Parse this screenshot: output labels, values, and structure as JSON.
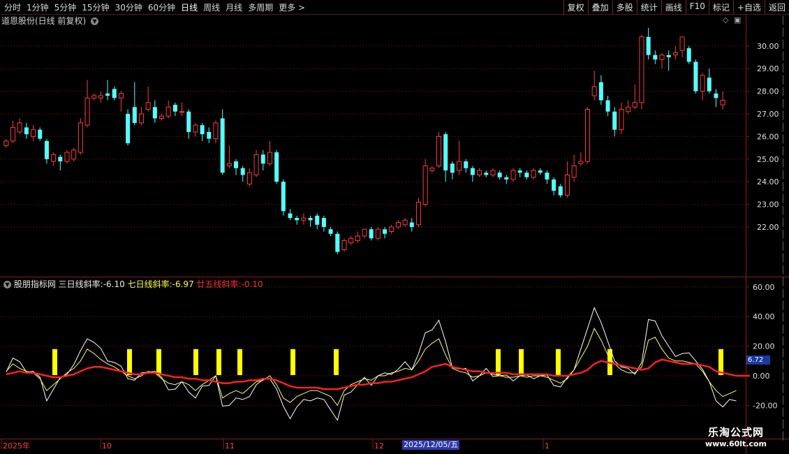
{
  "toolbar": {
    "periods": [
      "分时",
      "1分钟",
      "5分钟",
      "15分钟",
      "30分钟",
      "60分钟",
      "日线",
      "周线",
      "月线",
      "多周期",
      "更多 >"
    ],
    "active_period": "日线",
    "actions": [
      "复权",
      "叠加",
      "多股",
      "统计",
      "画线",
      "F10",
      "标记",
      "+自选",
      "返回"
    ]
  },
  "main_panel": {
    "title": "道恩股份(日线 前复权)",
    "price_ticks": [
      "30.00",
      "29.00",
      "28.00",
      "27.00",
      "26.00",
      "25.00",
      "24.00",
      "23.00",
      "22.00"
    ]
  },
  "indicator_panel": {
    "name": "股朋指标网",
    "line1_label": "三日线斜率:",
    "line1_value": "-6.10",
    "line2_label": "七日线斜率:",
    "line2_value": "-6.97",
    "line3_label": "廿五线斜率:",
    "line3_value": "-0.10",
    "ticks": [
      "60.00",
      "40.00",
      "20.00",
      "0.00",
      "-20.00"
    ],
    "current_value": "6.72"
  },
  "date_axis": {
    "labels": [
      "2025年",
      "10",
      "11",
      "12",
      "1"
    ],
    "cursor_date": "2025/12/05/五"
  },
  "watermark": {
    "line1": "乐淘公式网",
    "line2": "www.60lt.com"
  },
  "colors": {
    "up": "#ff3b3b",
    "down": "#54ffff",
    "bg": "#000000",
    "grid": "#7a1a1a",
    "signal": "#ffff00"
  },
  "chart_data": {
    "type": "candlestick",
    "price_axis": {
      "ylim": [
        21.0,
        31.0
      ]
    },
    "candles": [
      [
        25.6,
        25.8,
        25.5,
        25.9
      ],
      [
        25.8,
        26.4,
        25.7,
        26.7
      ],
      [
        26.2,
        26.6,
        26.1,
        26.8
      ],
      [
        26.4,
        26.1,
        25.9,
        26.6
      ],
      [
        26.0,
        26.3,
        25.8,
        26.5
      ],
      [
        26.3,
        25.9,
        25.8,
        26.4
      ],
      [
        25.8,
        25.0,
        24.8,
        25.9
      ],
      [
        24.9,
        25.2,
        24.7,
        25.3
      ],
      [
        25.1,
        24.9,
        24.5,
        25.2
      ],
      [
        24.9,
        25.3,
        24.8,
        25.4
      ],
      [
        25.0,
        25.4,
        24.9,
        25.5
      ],
      [
        25.3,
        26.6,
        25.2,
        26.8
      ],
      [
        26.5,
        27.7,
        26.4,
        28.5
      ],
      [
        27.7,
        27.8,
        27.6,
        27.9
      ],
      [
        27.7,
        27.8,
        27.5,
        28.0
      ],
      [
        27.9,
        27.8,
        27.6,
        28.5
      ],
      [
        28.1,
        27.7,
        27.6,
        28.2
      ],
      [
        27.7,
        27.9,
        27.1,
        28.0
      ],
      [
        27.0,
        25.7,
        25.6,
        27.2
      ],
      [
        27.3,
        26.6,
        26.5,
        28.4
      ],
      [
        26.6,
        27.0,
        26.5,
        27.3
      ],
      [
        27.2,
        27.5,
        27.1,
        28.2
      ],
      [
        27.3,
        26.8,
        26.6,
        27.6
      ],
      [
        26.8,
        26.9,
        26.7,
        27.0
      ],
      [
        26.9,
        27.3,
        26.8,
        27.6
      ],
      [
        27.4,
        27.1,
        26.9,
        27.5
      ],
      [
        27.1,
        27.1,
        26.9,
        27.5
      ],
      [
        27.1,
        26.2,
        25.9,
        27.2
      ],
      [
        26.2,
        26.5,
        26.0,
        26.6
      ],
      [
        26.5,
        26.1,
        25.8,
        26.6
      ],
      [
        26.2,
        25.9,
        25.7,
        26.4
      ],
      [
        25.9,
        26.6,
        25.7,
        26.7
      ],
      [
        26.8,
        24.4,
        24.3,
        27.2
      ],
      [
        24.7,
        24.8,
        24.6,
        25.6
      ],
      [
        24.9,
        24.6,
        24.3,
        25.0
      ],
      [
        24.6,
        24.3,
        24.0,
        24.7
      ],
      [
        23.9,
        24.4,
        23.8,
        24.6
      ],
      [
        24.3,
        25.2,
        24.2,
        25.4
      ],
      [
        25.2,
        24.8,
        24.5,
        25.4
      ],
      [
        24.8,
        25.3,
        24.7,
        25.8
      ],
      [
        25.3,
        24.0,
        23.9,
        25.4
      ],
      [
        24.0,
        22.7,
        22.5,
        24.1
      ],
      [
        22.6,
        22.4,
        22.3,
        22.8
      ],
      [
        22.4,
        22.3,
        22.1,
        22.5
      ],
      [
        22.3,
        22.4,
        22.1,
        22.6
      ],
      [
        22.4,
        22.3,
        22.0,
        22.5
      ],
      [
        22.5,
        22.1,
        21.9,
        22.6
      ],
      [
        22.4,
        22.0,
        21.8,
        22.5
      ],
      [
        21.9,
        21.7,
        21.6,
        22.0
      ],
      [
        21.7,
        20.9,
        20.8,
        21.8
      ],
      [
        21.0,
        21.4,
        20.9,
        21.5
      ],
      [
        21.3,
        21.5,
        21.2,
        21.6
      ],
      [
        21.4,
        21.6,
        21.3,
        21.8
      ],
      [
        21.6,
        21.9,
        21.5,
        21.9
      ],
      [
        21.9,
        21.5,
        21.4,
        22.0
      ],
      [
        21.5,
        21.9,
        21.4,
        22.0
      ],
      [
        21.9,
        21.7,
        21.5,
        22.0
      ],
      [
        21.8,
        22.0,
        21.7,
        22.1
      ],
      [
        22.0,
        22.2,
        21.9,
        22.3
      ],
      [
        22.1,
        22.3,
        22.0,
        22.4
      ],
      [
        22.2,
        22.0,
        21.8,
        22.4
      ],
      [
        22.1,
        23.1,
        22.0,
        23.3
      ],
      [
        23.0,
        24.7,
        22.9,
        25.0
      ],
      [
        24.5,
        24.6,
        24.4,
        24.7
      ],
      [
        24.7,
        26.0,
        24.6,
        26.2
      ],
      [
        26.1,
        24.5,
        24.0,
        26.2
      ],
      [
        24.8,
        24.4,
        24.1,
        24.9
      ],
      [
        24.5,
        24.9,
        24.3,
        25.8
      ],
      [
        24.9,
        24.6,
        24.4,
        25.0
      ],
      [
        24.6,
        24.3,
        24.0,
        24.7
      ],
      [
        24.3,
        24.5,
        24.2,
        24.6
      ],
      [
        24.4,
        24.3,
        24.2,
        24.5
      ],
      [
        24.3,
        24.5,
        24.2,
        24.6
      ],
      [
        24.4,
        24.2,
        24.1,
        24.5
      ],
      [
        24.2,
        24.1,
        23.9,
        24.3
      ],
      [
        24.1,
        24.5,
        24.0,
        24.6
      ],
      [
        24.5,
        24.4,
        24.2,
        24.6
      ],
      [
        24.4,
        24.2,
        24.1,
        24.5
      ],
      [
        24.2,
        24.5,
        24.1,
        24.6
      ],
      [
        24.5,
        24.4,
        24.3,
        24.6
      ],
      [
        24.4,
        24.1,
        23.9,
        24.5
      ],
      [
        24.1,
        23.6,
        23.4,
        24.2
      ],
      [
        23.8,
        23.4,
        23.3,
        23.9
      ],
      [
        23.4,
        24.3,
        23.3,
        24.9
      ],
      [
        24.2,
        24.7,
        24.0,
        25.2
      ],
      [
        24.8,
        24.9,
        24.7,
        25.3
      ],
      [
        24.9,
        27.2,
        24.8,
        27.3
      ],
      [
        27.8,
        28.2,
        27.6,
        28.9
      ],
      [
        28.4,
        27.6,
        27.4,
        28.7
      ],
      [
        27.6,
        27.1,
        26.9,
        27.8
      ],
      [
        27.1,
        26.3,
        26.0,
        27.3
      ],
      [
        26.3,
        27.2,
        26.1,
        27.5
      ],
      [
        27.1,
        27.3,
        27.0,
        27.6
      ],
      [
        27.3,
        27.5,
        27.2,
        28.3
      ],
      [
        27.5,
        30.4,
        27.2,
        30.5
      ],
      [
        30.4,
        29.6,
        29.4,
        30.8
      ],
      [
        29.6,
        29.4,
        29.2,
        29.8
      ],
      [
        29.4,
        29.6,
        29.0,
        29.7
      ],
      [
        29.6,
        29.5,
        28.9,
        29.8
      ],
      [
        29.6,
        29.7,
        29.4,
        30.0
      ],
      [
        29.8,
        30.4,
        29.5,
        30.4
      ],
      [
        29.9,
        29.3,
        29.2,
        30.0
      ],
      [
        29.3,
        28.0,
        27.9,
        29.4
      ],
      [
        28.0,
        28.7,
        27.6,
        28.8
      ],
      [
        28.6,
        28.0,
        27.9,
        29.0
      ],
      [
        27.9,
        27.7,
        27.3,
        28.1
      ],
      [
        27.4,
        27.6,
        27.2,
        28.0
      ]
    ],
    "indicator": {
      "ylim": [
        -35,
        65
      ],
      "signal_bars_at": [
        13,
        30,
        50,
        78,
        121,
        142,
        147,
        207,
        218,
        220,
        223,
        233,
        255,
        263,
        284,
        324,
        335,
        337,
        340,
        346,
        351,
        413,
        445,
        466,
        472,
        474,
        477,
        505,
        515,
        517,
        520,
        553
      ],
      "signal_top": 18,
      "line3": [
        1,
        2,
        3,
        2,
        2,
        1,
        0,
        -1,
        -1,
        0,
        1,
        3,
        5,
        6,
        6,
        5,
        4,
        3,
        2,
        1,
        1,
        2,
        2,
        1,
        0,
        -1,
        -1,
        -2,
        -2,
        -3,
        -3,
        -4,
        -5,
        -5,
        -4,
        -4,
        -3,
        -3,
        -2,
        -2,
        -3,
        -5,
        -7,
        -8,
        -8,
        -8,
        -8,
        -9,
        -9,
        -9,
        -8,
        -7,
        -6,
        -6,
        -5,
        -5,
        -4,
        -4,
        -3,
        -2,
        -1,
        1,
        3,
        6,
        7,
        8,
        6,
        5,
        4,
        3,
        3,
        2,
        2,
        2,
        2,
        1,
        1,
        1,
        1,
        1,
        1,
        0,
        0,
        0,
        1,
        2,
        4,
        8,
        10,
        9,
        8,
        7,
        6,
        5,
        4,
        5,
        9,
        11,
        10,
        9,
        8,
        8,
        8,
        7,
        6,
        3,
        2,
        1,
        0,
        0,
        0
      ],
      "line2": [
        3,
        8,
        5,
        3,
        2,
        -2,
        -10,
        -6,
        -2,
        2,
        5,
        10,
        18,
        15,
        11,
        8,
        6,
        3,
        0,
        -2,
        0,
        3,
        2,
        -2,
        -5,
        -6,
        -4,
        -6,
        -10,
        -6,
        -3,
        0,
        -15,
        -12,
        -10,
        -12,
        -8,
        -4,
        -3,
        0,
        -6,
        -15,
        -18,
        -14,
        -12,
        -10,
        -10,
        -12,
        -14,
        -20,
        -10,
        -6,
        -4,
        -2,
        -3,
        0,
        0,
        2,
        3,
        5,
        4,
        10,
        18,
        22,
        25,
        14,
        5,
        3,
        2,
        -1,
        0,
        2,
        1,
        0,
        -1,
        -1,
        0,
        -1,
        0,
        0,
        -1,
        -3,
        -5,
        -2,
        4,
        12,
        20,
        32,
        24,
        14,
        8,
        4,
        2,
        2,
        6,
        24,
        26,
        18,
        12,
        10,
        10,
        9,
        8,
        3,
        -4,
        -10,
        -14,
        -12,
        -10
      ]
    }
  }
}
